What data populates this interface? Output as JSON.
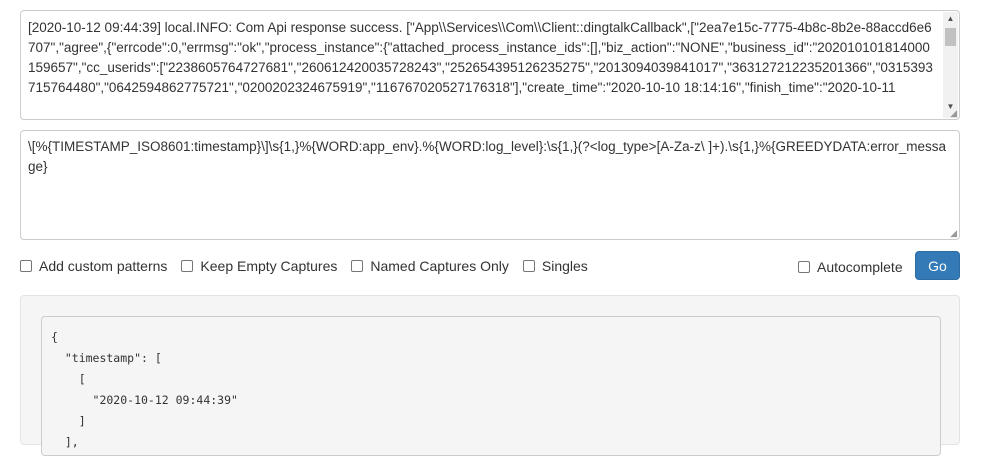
{
  "input": {
    "log_text": "[2020-10-12 09:44:39] local.INFO: Com Api response success. [\"App\\\\Services\\\\Com\\\\Client::dingtalkCallback\",[\"2ea7e15c-7775-4b8c-8b2e-88accd6e6707\",\"agree\",{\"errcode\":0,\"errmsg\":\"ok\",\"process_instance\":{\"attached_process_instance_ids\":[],\"biz_action\":\"NONE\",\"business_id\":\"202010101814000159657\",\"cc_userids\":[\"2238605764727681\",\"260612420035728243\",\"252654395126235275\",\"2013094039841017\",\"363127212235201366\",\"0315393715764480\",\"0642594862775721\",\"0200202324675919\",\"116767020527176318\"],\"create_time\":\"2020-10-10 18:14:16\",\"finish_time\":\"2020-10-11",
    "pattern_text": "\\[%{TIMESTAMP_ISO8601:timestamp}\\]\\s{1,}%{WORD:app_env}.%{WORD:log_level}:\\s{1,}(?<log_type>[A-Za-z\\ ]+).\\s{1,}%{GREEDYDATA:error_message}"
  },
  "options": {
    "add_custom_patterns": "Add custom patterns",
    "keep_empty_captures": "Keep Empty Captures",
    "named_captures_only": "Named Captures Only",
    "singles": "Singles",
    "autocomplete": "Autocomplete",
    "go_label": "Go"
  },
  "result": {
    "lines": [
      "{",
      "  \"timestamp\": [",
      "    [",
      "      \"2020-10-12 09:44:39\"",
      "    ]",
      "  ],"
    ]
  }
}
